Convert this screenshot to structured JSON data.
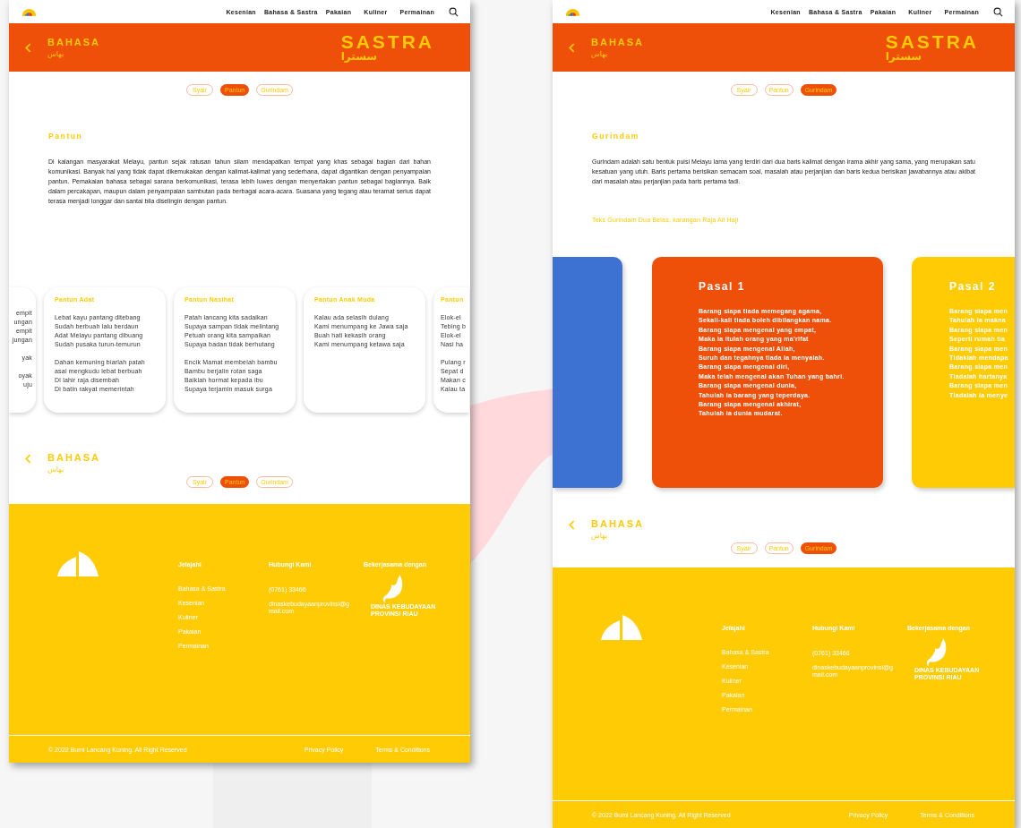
{
  "screens": [
    {
      "kind": "pantun",
      "nav": {
        "items": [
          "Kesenian",
          "Bahasa & Sastra",
          "Pakaian",
          "Kuliner",
          "Permainan"
        ]
      },
      "header": {
        "title": "BAHASA",
        "title_arabic": "بهاس",
        "page": "SASTRA",
        "page_arabic": "سسترا"
      },
      "tabs": [
        {
          "label": "Syair",
          "selected": false
        },
        {
          "label": "Pantun",
          "selected": true
        },
        {
          "label": "Gurindam",
          "selected": false
        }
      ],
      "section_title": "Pantun",
      "paragraph": "Di kalangan masyarakat Melayu, pantun sejak ratusan tahun silam mendapatkan tempat yang khas sebagai bagian dari bahan komunikasi. Banyak hal yang tidak dapat dikemukakan dengan kalimat-kalimat yang sederhana, dapat digantikan dengan penyampaian pantun. Pemakaian bahasa sebagai sarana berkomunikasi, terasa lebih luwes dengan menyertakan pantun sebagai bagiannya. Baik dalam percakapan, maupun dalam penyampaian sambutan pada berbagai acara-acara. Suasana yang tegang atau teramat serius dapat terasa menjadi longgar dan santai bila diselingin dengan pantun.",
      "cards": [
        {
          "kind": "cut_left",
          "stanzas": [
            [
              "empit",
              "ungan",
              "empit",
              "jungan"
            ],
            [
              "yak"
            ],
            [
              "oyak",
              "uju"
            ]
          ]
        },
        {
          "kind": "full",
          "title": "Pantun Adat",
          "stanzas": [
            [
              "Lebat kayu pantang ditebang",
              "Sudah berbuah lalu berdaun",
              "Adat Melayu pantang dibuang",
              "Sudah pusaka turun-temurun"
            ],
            [
              "Dahan kemuning biarlah patah",
              "asal mengkudu lebat berbuah",
              "Di lahir raja disembah",
              "Di batin rakyat memerintah"
            ]
          ]
        },
        {
          "kind": "full",
          "title": "Pantun Nasihat",
          "stanzas": [
            [
              "Patah lancang kita sadaikan",
              "Supaya sampan tidak melintang",
              "Petuah orang kita sampaikan",
              "Supaya badan tidak berhutang"
            ],
            [
              "Encik Mamat membelah bambu",
              "Bambu berjalin rotan saga",
              "Baiklah hormat kepada ibu",
              "Supaya terjamin masuk surga"
            ]
          ]
        },
        {
          "kind": "full",
          "title": "Pantun Anak Muda",
          "stanzas": [
            [
              "Kalau ada selasih dulang",
              "Kami menumpang ke Jawa saja",
              "Buah hati kekasih orang",
              "Kami menumpang ketawa saja"
            ]
          ]
        },
        {
          "kind": "cut_right",
          "title": "Pantun",
          "stanzas": [
            [
              "Elok-el",
              "Tebing b",
              "Elok-el",
              "Nasi ha"
            ],
            [
              "Pulang r",
              "Sepat d",
              "Makan c",
              "Kalau ta"
            ]
          ]
        }
      ],
      "bottom_nav": {
        "title": "BAHASA",
        "title_arabic": "بهاس",
        "tabs": [
          {
            "label": "Syair",
            "selected": false
          },
          {
            "label": "Pantun",
            "selected": true
          },
          {
            "label": "Gurindam",
            "selected": false
          }
        ]
      },
      "footer": {
        "explore": {
          "heading": "Jelajahi",
          "links": [
            "Bahasa & Sastra",
            "Kesenian",
            "Kuliner",
            "Pakaian",
            "Permainan"
          ]
        },
        "contact": {
          "heading": "Hubungi Kami",
          "phone": "(0761) 33466",
          "email": "dinaskebudayaanprovinsi@gmail.com"
        },
        "partner": {
          "heading": "Bekerjasama dengan",
          "logo_text": "DINAS KEBUDAYAAN PROVINSI RIAU"
        },
        "copyright": "© 2022 Bumi Lancang Kuning. All Right Reserved",
        "links": [
          "Privacy Policy",
          "Terms & Conditions"
        ]
      }
    },
    {
      "kind": "gurindam",
      "nav": {
        "items": [
          "Kesenian",
          "Bahasa & Sastra",
          "Pakaian",
          "Kuliner",
          "Permainan"
        ]
      },
      "header": {
        "title": "BAHASA",
        "title_arabic": "بهاس",
        "page": "SASTRA",
        "page_arabic": "سسترا"
      },
      "tabs": [
        {
          "label": "Syair",
          "selected": false
        },
        {
          "label": "Pantun",
          "selected": false
        },
        {
          "label": "Gurindam",
          "selected": true
        }
      ],
      "section_title": "Gurindam",
      "paragraph": "Gurindam adalah satu bentuk puisi Melayu lama yang terdiri dari dua baris kalimat dengan irama akhir yang sama, yang merupakan satu kesatuan yang utuh. Baris pertama berisikan semacam soal, masalah atau perjanjian dan baris kedua berisikan jawabannya atau akibat dari masalah atau perjanjian pada baris pertama tadi.",
      "caption": "Teks Gurindam Dua Belas, karangan Raja Ali Haji",
      "cards": [
        {
          "kind": "blank",
          "color": "#3d72d3"
        },
        {
          "kind": "full",
          "color": "#ee500a",
          "title": "Pasal 1",
          "stanzas": [
            [
              "Barang siapa tiada memegang agama,",
              "Sekali-kali tiada boleh dibilangkan nama.",
              "Barang siapa mengenal yang empat,",
              "Maka ia itulah orang yang ma'rifat",
              "Barang siapa mengenal Allah,",
              "Suruh dan tegahnya tiada ia menyalah.",
              "Barang siapa mengenal diri,",
              "Maka telah mengenal akan Tuhan yang bahri.",
              "Barang siapa mengenal dunia,",
              "Tahulah ia barang yang teperdaya.",
              "Barang siapa mengenal akhirat,",
              "Tahulah ia dunia mudarat."
            ]
          ]
        },
        {
          "kind": "cut_right",
          "color": "#ffcb05",
          "title": "Pasal 2",
          "stanzas": [
            [
              "Barang siapa men",
              "Tahulah ia makna",
              "Barang siapa men",
              "Seperti rumah tia",
              "Barang siapa men",
              "Tidaklah mendapa",
              "Barang siapa men",
              "Tiadalah hartanya",
              "Barang siapa men",
              "Tiadalah ia menye"
            ]
          ]
        }
      ],
      "bottom_nav": {
        "title": "BAHASA",
        "title_arabic": "بهاس",
        "tabs": [
          {
            "label": "Syair",
            "selected": false
          },
          {
            "label": "Pantun",
            "selected": false
          },
          {
            "label": "Gurindam",
            "selected": true
          }
        ]
      },
      "footer": {
        "explore": {
          "heading": "Jelajahi",
          "links": [
            "Bahasa & Sastra",
            "Kesenian",
            "Kuliner",
            "Pakaian",
            "Permainan"
          ]
        },
        "contact": {
          "heading": "Hubungi Kami",
          "phone": "(0761) 33466",
          "email": "dinaskebudayaanprovinsi@gmail.com"
        },
        "partner": {
          "heading": "Bekerjasama dengan",
          "logo_text": "DINAS KEBUDAYAAN PROVINSI RIAU"
        },
        "copyright": "© 2022 Bumi Lancang Kuning. All Right Reserved",
        "links": [
          "Privacy Policy",
          "Terms & Conditions"
        ]
      }
    }
  ]
}
